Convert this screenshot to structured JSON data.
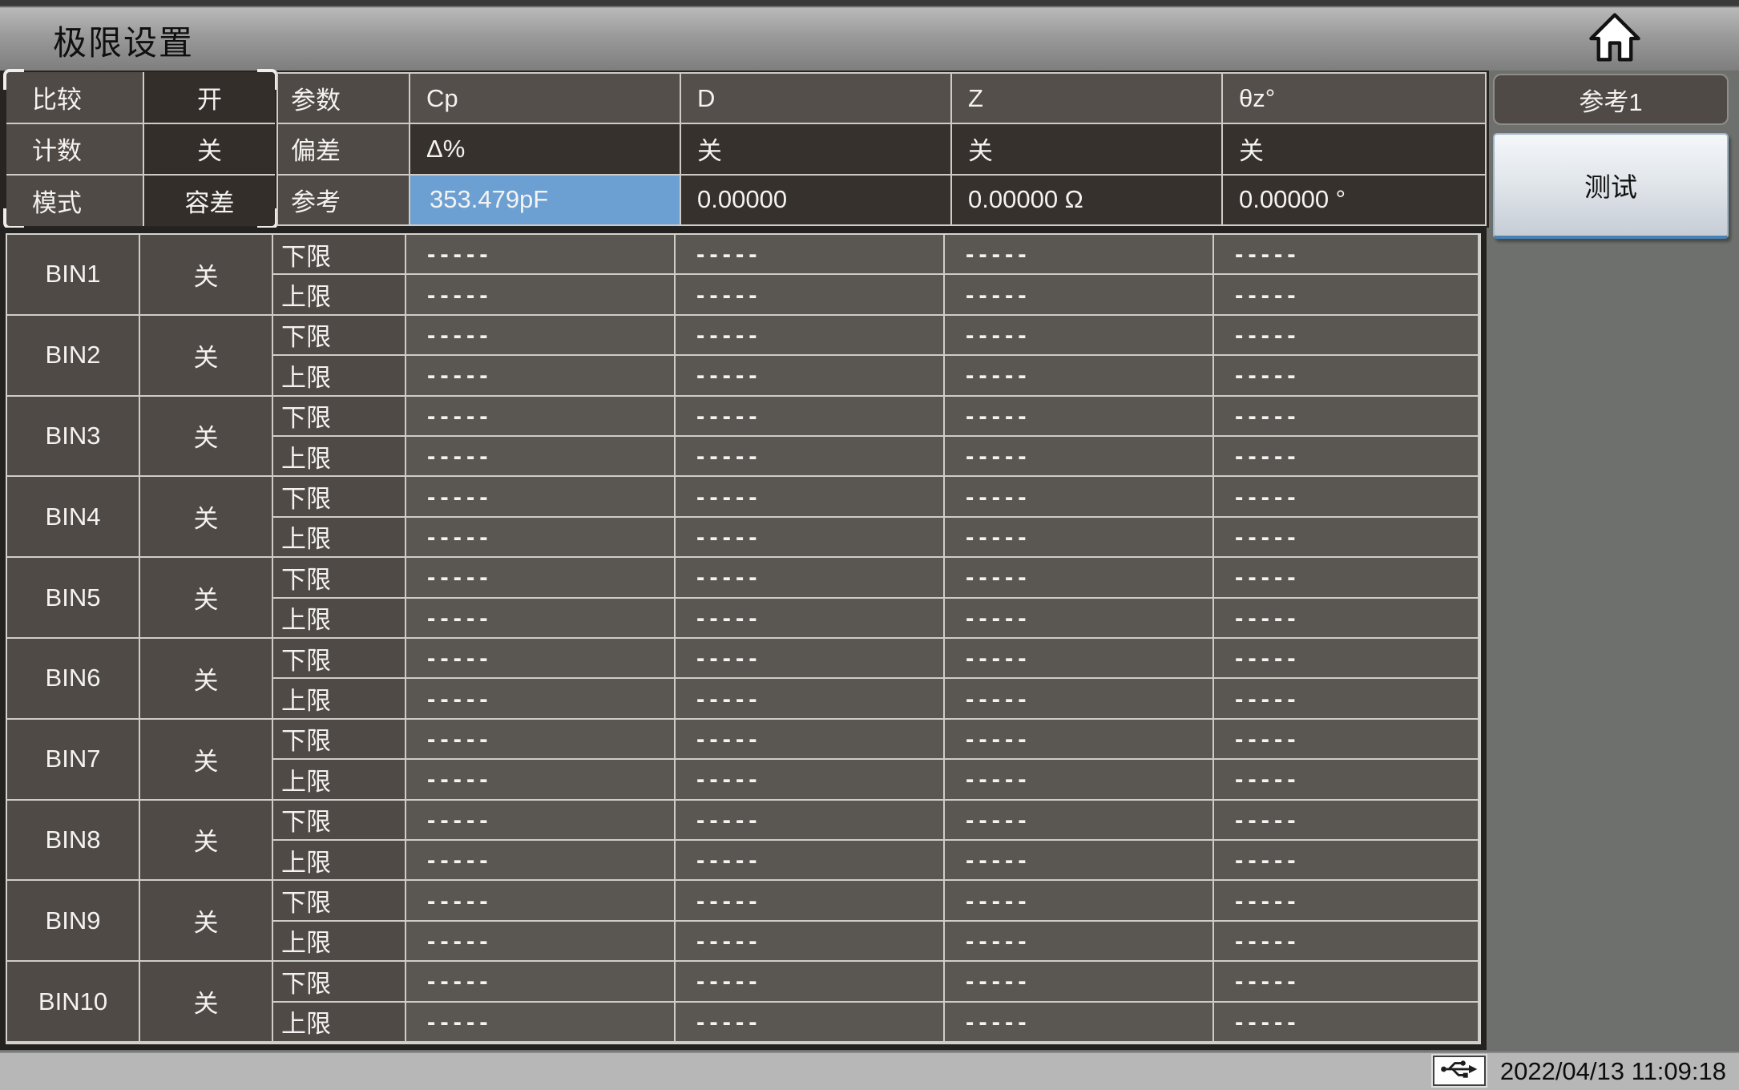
{
  "title_bar": {
    "title": "极限设置"
  },
  "comparator_panel": {
    "rows": [
      {
        "label": "比较",
        "value": "开"
      },
      {
        "label": "计数",
        "value": "关"
      },
      {
        "label": "模式",
        "value": "容差"
      }
    ]
  },
  "parameter_table": {
    "param_row": {
      "label": "参数",
      "values": [
        "Cp",
        "D",
        "Z",
        "θz°"
      ]
    },
    "deviation_row": {
      "label": "偏差",
      "values": [
        "Δ%",
        "关",
        "关",
        "关"
      ]
    },
    "reference_row": {
      "label": "参考",
      "values": [
        "353.479pF",
        "0.00000",
        "0.00000 Ω",
        "0.00000 °"
      ],
      "highlighted_index": 0
    }
  },
  "bin_table": {
    "lower_label": "下限",
    "upper_label": "上限",
    "empty_value": "-----",
    "bins": [
      {
        "name": "BIN1",
        "state": "关"
      },
      {
        "name": "BIN2",
        "state": "关"
      },
      {
        "name": "BIN3",
        "state": "关"
      },
      {
        "name": "BIN4",
        "state": "关"
      },
      {
        "name": "BIN5",
        "state": "关"
      },
      {
        "name": "BIN6",
        "state": "关"
      },
      {
        "name": "BIN7",
        "state": "关"
      },
      {
        "name": "BIN8",
        "state": "关"
      },
      {
        "name": "BIN9",
        "state": "关"
      },
      {
        "name": "BIN10",
        "state": "关"
      }
    ]
  },
  "side_panel": {
    "reference_button": "参考1",
    "test_button": "测试"
  },
  "status_bar": {
    "timestamp": "2022/04/13 11:09:18"
  },
  "colors": {
    "highlight_cell": "#6CA0D3",
    "cell_dark": "#36312C",
    "cell_label": "#4F4A46",
    "cell_value": "#5A5651",
    "test_button_border": "#4A80B2"
  }
}
